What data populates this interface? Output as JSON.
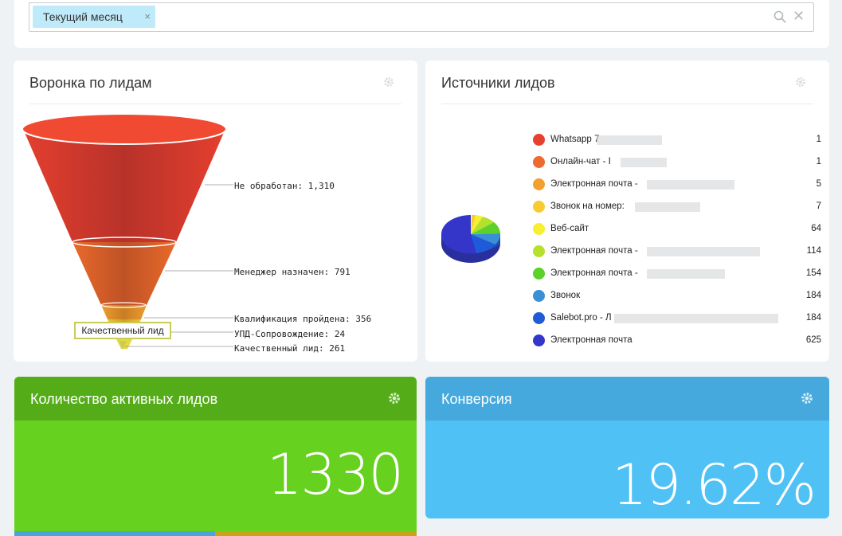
{
  "filter": {
    "chip_label": "Текущий месяц",
    "chip_remove": "×",
    "clear_icon": "✕"
  },
  "funnel_widget": {
    "title": "Воронка по лидам",
    "tooltip": "Качественный лид",
    "stages": [
      {
        "label": "Не обработан: 1,310",
        "value": 1310,
        "color": "#e43f2e"
      },
      {
        "label": "Менеджер назначен: 791",
        "value": 791,
        "color": "#e86a2a"
      },
      {
        "label": "Квалификация пройдена: 356",
        "value": 356,
        "color": "#ec9c2e"
      },
      {
        "label": "УПД-Сопровождение: 24",
        "value": 24,
        "color": "#f0c232"
      },
      {
        "label": "Качественный лид: 261",
        "value": 261,
        "color": "#e6d93c"
      }
    ]
  },
  "sources_widget": {
    "title": "Источники лидов",
    "items": [
      {
        "label": "Whatsapp 7",
        "value": "1",
        "color": "#e8402f"
      },
      {
        "label": "Онлайн-чат - I",
        "value": "1",
        "color": "#ee6a30"
      },
      {
        "label": "Электронная почта -",
        "value": "5",
        "color": "#f4a02e"
      },
      {
        "label": "Звонок на номер:",
        "value": "7",
        "color": "#f8cb33"
      },
      {
        "label": "Веб-сайт",
        "value": "64",
        "color": "#f6f031"
      },
      {
        "label": "Электронная почта -",
        "value": "114",
        "color": "#b4e12c"
      },
      {
        "label": "Электронная почта -",
        "value": "154",
        "color": "#5bd12a"
      },
      {
        "label": "Звонок",
        "value": "184",
        "color": "#3b8fd6"
      },
      {
        "label": "Salebot.pro - Л",
        "value": "184",
        "color": "#1f5bd8"
      },
      {
        "label": "Электронная почта",
        "value": "625",
        "color": "#3435c9"
      }
    ]
  },
  "kpi_active": {
    "title": "Количество активных лидов",
    "value": "1330"
  },
  "kpi_conversion": {
    "title": "Конверсия",
    "value": "19.62%"
  },
  "colors": {
    "accent_green": "#67d11f",
    "accent_blue": "#4fc1f5"
  }
}
